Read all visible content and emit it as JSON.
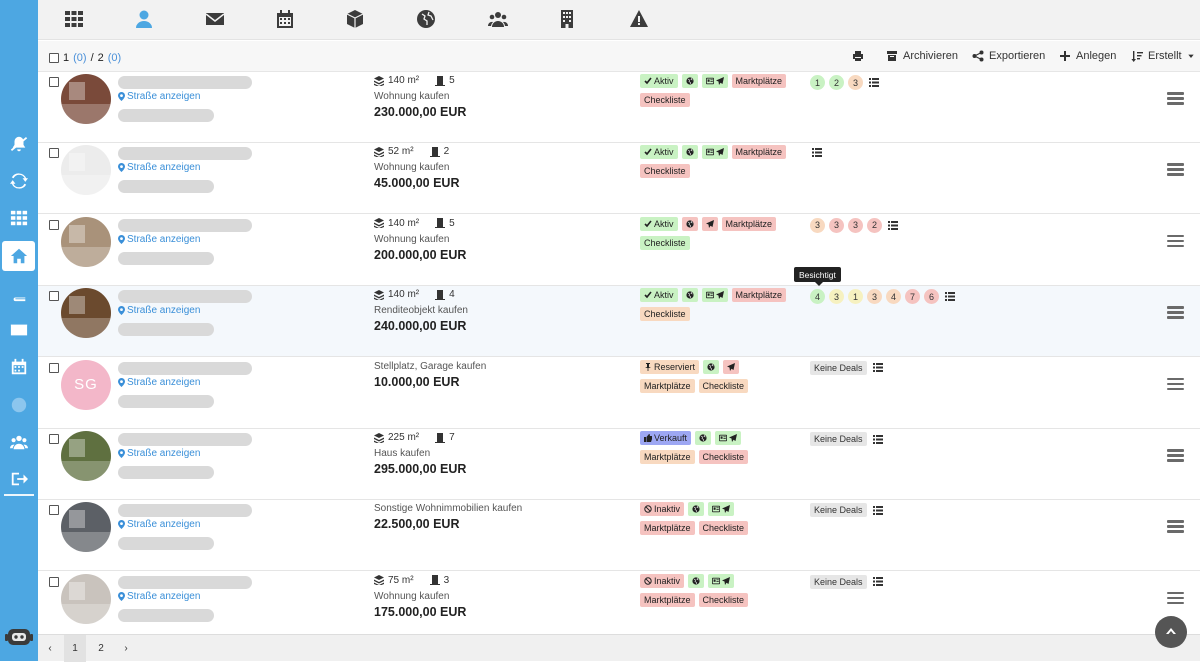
{
  "toolbar": {
    "selection_sel": "1",
    "selection_sel_count": "(0)",
    "selection_sep": "/",
    "selection_total": "2",
    "selection_total_count": "(0)",
    "archive": "Archivieren",
    "export": "Exportieren",
    "create": "Anlegen",
    "sort": "Erstellt"
  },
  "nav_icons": [
    "grid-icon",
    "user-icon",
    "mail-icon",
    "calendar-icon",
    "cube-icon",
    "globe-icon",
    "users-icon",
    "building-icon",
    "warning-icon"
  ],
  "sidebar_icons": [
    "bell-off-icon",
    "sync-icon",
    "grid-icon",
    "home-icon",
    "book-icon",
    "mail-icon",
    "calendar-icon",
    "globe-icon",
    "users-icon",
    "logout-icon",
    "robot-icon"
  ],
  "tooltip": "Besichtigt",
  "street_label": "Straße anzeigen",
  "rows": [
    {
      "area": "140 m²",
      "rooms": "5",
      "type": "Wohnung kaufen",
      "price": "230.000,00 EUR",
      "status": "Aktiv",
      "deals": [
        "1",
        "2",
        "3"
      ],
      "no_deals": ""
    },
    {
      "area": "52 m²",
      "rooms": "2",
      "type": "Wohnung kaufen",
      "price": "45.000,00 EUR",
      "status": "Aktiv",
      "deals": [],
      "no_deals": ""
    },
    {
      "area": "140 m²",
      "rooms": "5",
      "type": "Wohnung kaufen",
      "price": "200.000,00 EUR",
      "status": "Aktiv",
      "deals": [
        "3",
        "3",
        "3",
        "2"
      ],
      "no_deals": ""
    },
    {
      "area": "140 m²",
      "rooms": "4",
      "type": "Renditeobjekt kaufen",
      "price": "240.000,00 EUR",
      "status": "Aktiv",
      "deals": [
        "4",
        "3",
        "1",
        "3",
        "4",
        "7",
        "6"
      ],
      "no_deals": ""
    },
    {
      "area": "",
      "rooms": "",
      "type": "Stellplatz, Garage kaufen",
      "price": "10.000,00 EUR",
      "status": "Reserviert",
      "initials": "SG",
      "deals": [],
      "no_deals": "Keine Deals"
    },
    {
      "area": "225 m²",
      "rooms": "7",
      "type": "Haus kaufen",
      "price": "295.000,00 EUR",
      "status": "Verkauft",
      "deals": [],
      "no_deals": "Keine Deals"
    },
    {
      "area": "",
      "rooms": "",
      "type": "Sonstige Wohnimmobilien kaufen",
      "price": "22.500,00 EUR",
      "status": "Inaktiv",
      "deals": [],
      "no_deals": "Keine Deals"
    },
    {
      "area": "75 m²",
      "rooms": "3",
      "type": "Wohnung kaufen",
      "price": "175.000,00 EUR",
      "status": "Inaktiv",
      "deals": [],
      "no_deals": "Keine Deals"
    }
  ],
  "tag_labels": {
    "marketplaces": "Marktplätze",
    "checklist": "Checkliste"
  },
  "pager": {
    "prev": "‹",
    "pages": [
      "1",
      "2"
    ],
    "next": "›"
  },
  "colors": {
    "sidebar": "#4da7e2",
    "accent": "#4da7e2",
    "active_tag": "#c9f2c3",
    "red_tag": "#f5c3c0",
    "orange_tag": "#f8d9c0",
    "sold_tag": "#9da7f3"
  }
}
